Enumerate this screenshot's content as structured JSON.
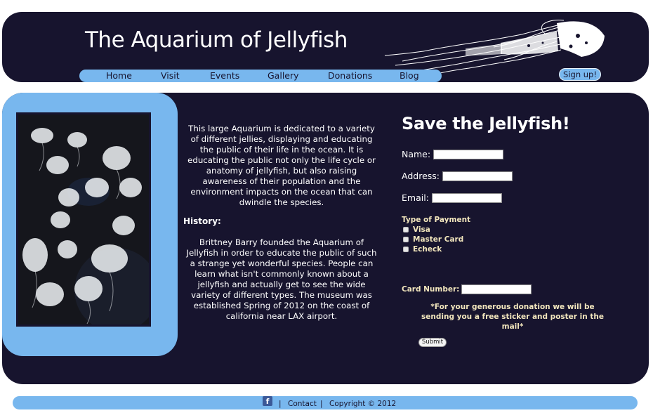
{
  "header": {
    "title": "The Aquarium of Jellyfish",
    "nav": [
      "Home",
      "Visit",
      "Events",
      "Gallery",
      "Donations",
      "Blog"
    ],
    "signup_label": "Sign up!"
  },
  "content": {
    "intro": "This large Aquarium is dedicated to a variety of different jellies, displaying and educating the public of their life in the ocean. It is educating the public not only the life cycle or anatomy of jellyfish, but also raising awareness of their population and the environment impacts on the ocean that can dwindle the species.",
    "history_heading": "History:",
    "history_text": "Brittney Barry founded the Aquarium of Jellyfish in order to educate the public of such a strange yet wonderful species. People can learn what isn't commonly known about a jellyfish and actually get to see the wide variety of different types. The museum was established Spring of 2012 on the coast of california near LAX airport."
  },
  "form": {
    "title": "Save the Jellyfish!",
    "name_label": "Name:",
    "address_label": "Address:",
    "email_label": "Email:",
    "payment_label": "Type of Payment",
    "payment_options": [
      "Visa",
      "Master Card",
      "Echeck"
    ],
    "card_label": "Card Number:",
    "note": "*For your generous donation we will be sending you a free sticker and poster in the mail*",
    "submit_label": "Submit"
  },
  "footer": {
    "facebook_icon": "f",
    "separator": "|",
    "contact": "Contact",
    "copyright": "Copyright © 2012"
  },
  "colors": {
    "navy": "#17142e",
    "light_blue": "#78b7ee",
    "cream": "#f2e6bd"
  }
}
